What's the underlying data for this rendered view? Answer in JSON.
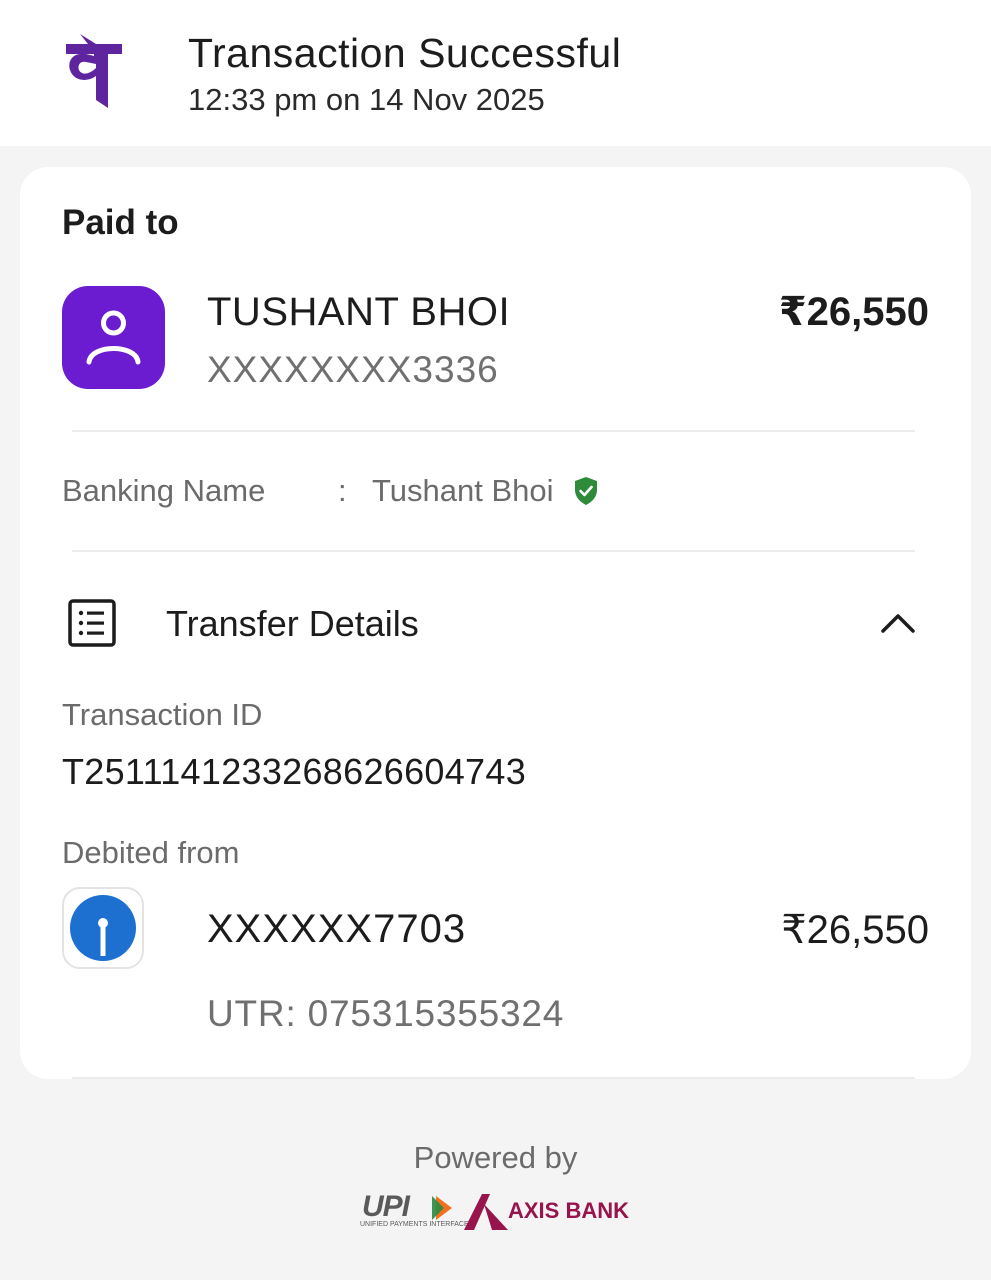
{
  "header": {
    "title": "Transaction Successful",
    "timestamp": "12:33 pm on 14 Nov 2025",
    "logo_icon": "phonepe-logo",
    "logo_color": "#5f259f"
  },
  "payee": {
    "section_title": "Paid to",
    "name": "TUSHANT BHOI",
    "account": "XXXXXXXX3336",
    "amount": "₹26,550",
    "avatar_icon": "person-icon",
    "avatar_color": "#6b1bd0"
  },
  "banking": {
    "label": "Banking Name",
    "separator": ":",
    "name": "Tushant Bhoi",
    "verified_icon": "verified-shield-icon",
    "verified_color": "#2e8b3a"
  },
  "transfer": {
    "title": "Transfer Details",
    "icon": "receipt-list-icon",
    "expand_icon": "chevron-up-icon",
    "transaction_id_label": "Transaction ID",
    "transaction_id": "T2511141233268626604743",
    "debited_from_label": "Debited from",
    "debit_account": "XXXXXX7703",
    "debit_amount": "₹26,550",
    "utr": "UTR: 075315355324",
    "bank_icon": "sbi-logo",
    "bank_color": "#1d6fd0"
  },
  "footer": {
    "powered_by": "Powered by",
    "upi_logo_text": "UPI",
    "upi_subtext": "UNIFIED PAYMENTS INTERFACE",
    "bank_partner": "AXIS BANK",
    "bank_partner_color": "#97144d"
  }
}
